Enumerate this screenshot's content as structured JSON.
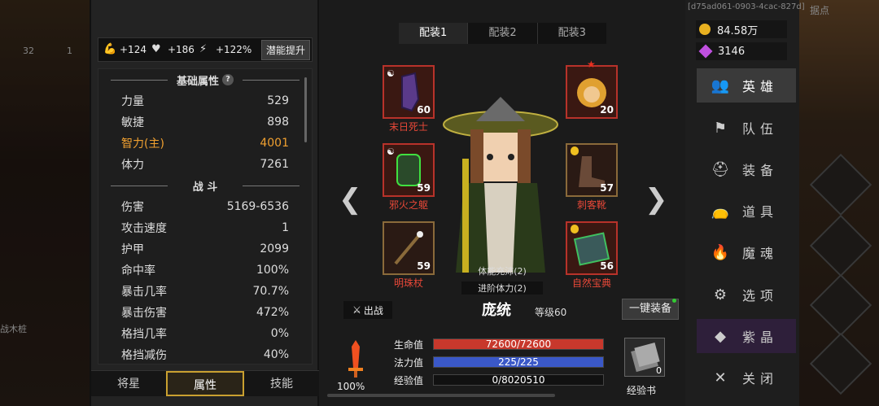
{
  "background": {
    "counts": [
      "32",
      "1"
    ],
    "label_left": "战木桩",
    "label_top_right": "据点"
  },
  "bonus": {
    "str": "+124",
    "hp": "+186",
    "energy": "+122%",
    "potential_button": "潜能提升"
  },
  "stats": {
    "base_header": "基础属性",
    "help": "?",
    "base": [
      {
        "label": "力量",
        "value": "529",
        "main": false
      },
      {
        "label": "敏捷",
        "value": "898",
        "main": false
      },
      {
        "label": "智力(主)",
        "value": "4001",
        "main": true
      },
      {
        "label": "体力",
        "value": "7261",
        "main": false
      }
    ],
    "combat_header": "战 斗",
    "combat": [
      {
        "label": "伤害",
        "value": "5169-6536"
      },
      {
        "label": "攻击速度",
        "value": "1"
      },
      {
        "label": "护甲",
        "value": "2099"
      },
      {
        "label": "命中率",
        "value": "100%"
      },
      {
        "label": "暴击几率",
        "value": "70.7%"
      },
      {
        "label": "暴击伤害",
        "value": "472%"
      },
      {
        "label": "格挡几率",
        "value": "0%"
      },
      {
        "label": "格挡减伤",
        "value": "40%"
      }
    ]
  },
  "bottom_tabs": [
    "将星",
    "属性",
    "技能"
  ],
  "loadouts": [
    "配装1",
    "配装2",
    "配装3"
  ],
  "equipment": {
    "head": {
      "name": "末日死士",
      "level": "60"
    },
    "body": {
      "name": "邪火之躯",
      "level": "59"
    },
    "weapon": {
      "name": "明珠杖",
      "level": "59"
    },
    "companion": {
      "name": "",
      "level": "20"
    },
    "boots": {
      "name": "刺客靴",
      "level": "57"
    },
    "book": {
      "name": "自然宝典",
      "level": "56"
    }
  },
  "buffs": [
    "体能充沛(2)",
    "进阶体力(2)"
  ],
  "hero": {
    "fight": "出战",
    "name": "庞统",
    "level": "等级60",
    "equip_all": "一键装备"
  },
  "bars": {
    "hp": {
      "label": "生命值",
      "value": "72600/72600",
      "fraction": 1.0,
      "color": "#c8382c"
    },
    "mp": {
      "label": "法力值",
      "value": "225/225",
      "fraction": 1.0,
      "color": "#3a58c8"
    },
    "exp": {
      "label": "经验值",
      "value": "0/8020510",
      "fraction": 0.0,
      "color": "#d0a030"
    }
  },
  "rage_pct": "100%",
  "expbook": {
    "label": "经验书",
    "count": "0"
  },
  "account_id": "[d75ad061-0903-4cac-827d]",
  "currency": {
    "gold": "84.58万",
    "gems": "3146"
  },
  "menu": [
    {
      "label": "英雄",
      "icon": "heroes-icon",
      "glyph": "👥"
    },
    {
      "label": "队伍",
      "icon": "flag-icon",
      "glyph": "⚑"
    },
    {
      "label": "装备",
      "icon": "helmet-icon",
      "glyph": "⛑"
    },
    {
      "label": "道具",
      "icon": "bag-icon",
      "glyph": "👝"
    },
    {
      "label": "魔魂",
      "icon": "flame-icon",
      "glyph": "🔥"
    },
    {
      "label": "选项",
      "icon": "gear-icon",
      "glyph": "⚙"
    },
    {
      "label": "紫晶",
      "icon": "crystal-icon",
      "glyph": "◆"
    },
    {
      "label": "关闭",
      "icon": "close-icon",
      "glyph": "✕"
    }
  ]
}
